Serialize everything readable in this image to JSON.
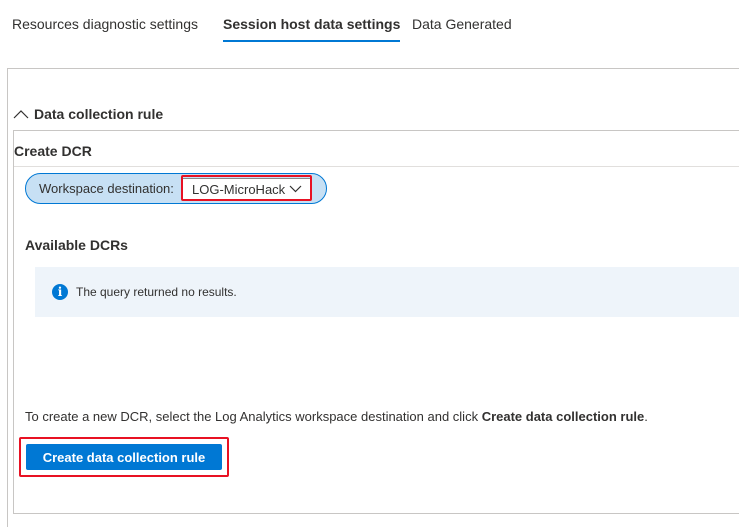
{
  "tabs": [
    {
      "label": "Resources diagnostic settings",
      "active": false
    },
    {
      "label": "Session host data settings",
      "active": true
    },
    {
      "label": "Data Generated",
      "active": false
    }
  ],
  "section": {
    "title": "Data collection rule",
    "expanded": true,
    "icon": "chevron-up-icon"
  },
  "create_dcr": {
    "title": "Create DCR",
    "workspace_label": "Workspace destination:",
    "workspace_value": "LOG-MicroHack"
  },
  "available": {
    "title": "Available DCRs",
    "info_icon": "info-icon",
    "info_text": "The query returned no results."
  },
  "instruction": {
    "prefix": "To create a new DCR, select the Log Analytics workspace destination and click ",
    "bold": "Create data collection rule",
    "suffix": "."
  },
  "create_button_label": "Create data collection rule",
  "colors": {
    "accent": "#0078d4",
    "highlight": "#e81123",
    "pill_background": "#c7e0f4",
    "info_background": "#eef4fa"
  }
}
